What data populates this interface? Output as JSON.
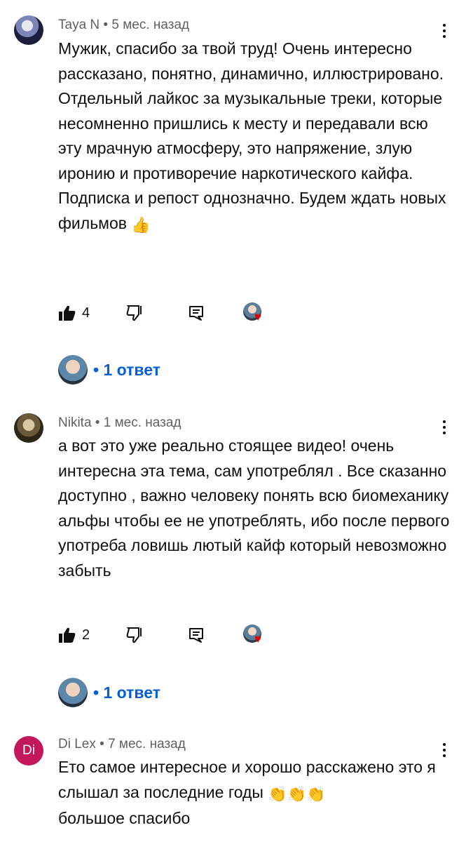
{
  "comments": [
    {
      "author": "Taya N",
      "separator": "•",
      "time": "5 мес. назад",
      "text": "Мужик, спасибо за твой труд! Очень интересно рассказано, понятно, динамично, иллюстрировано. Отдельный лайкос за музыкальные треки, которые несомненно пришлись к месту и передавали всю эту мрачную атмосферу, это напряжение, злую иронию и противоречие наркотического кайфа.",
      "text2": "Подписка и репост однозначно. Будем ждать новых фильмов",
      "emoji": "👍",
      "likes": "4",
      "replies": "• 1 ответ"
    },
    {
      "author": "Nikita",
      "separator": "•",
      "time": "1 мес. назад",
      "text": "а вот это уже реально стоящее видео! очень интересна эта тема, сам употреблял . Все сказанно доступно , важно человеку понять всю биомеханику альфы чтобы ее не употреблять, ибо после первого употреба ловишь лютый кайф который невозможно забыть",
      "likes": "2",
      "replies": "• 1 ответ"
    },
    {
      "author": "Di Lex",
      "avatar_initials": "Di",
      "separator": "•",
      "time": "7 мес. назад",
      "text": "Ето самое интересное и хорошо расскажено это я слышал за последние годы",
      "emoji": "👏👏👏",
      "text2": "большое спасибо"
    }
  ],
  "colors": {
    "link": "#065fd4",
    "meta": "#606060",
    "heart": "#e00000",
    "avatar_di": "#c2185b"
  }
}
